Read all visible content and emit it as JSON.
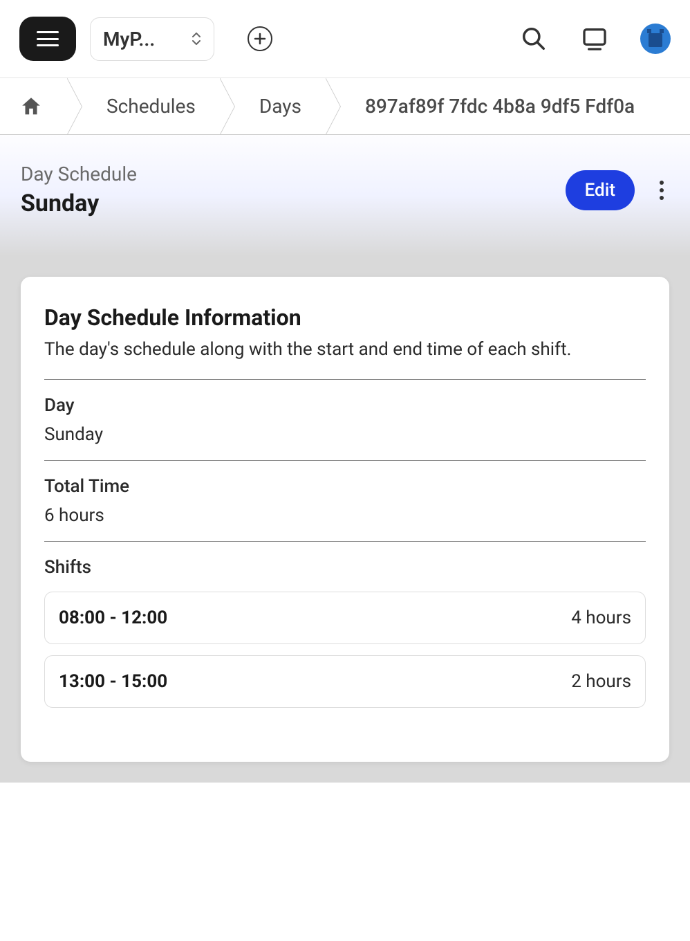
{
  "topbar": {
    "project_label": "MyP..."
  },
  "breadcrumb": {
    "items": [
      "Schedules",
      "Days",
      "897af89f 7fdc 4b8a 9df5 Fdf0a"
    ]
  },
  "header": {
    "subtitle": "Day Schedule",
    "title": "Sunday",
    "edit_label": "Edit"
  },
  "card": {
    "title": "Day Schedule Information",
    "description": "The day's schedule along with the start and end time of each shift.",
    "fields": {
      "day": {
        "label": "Day",
        "value": "Sunday"
      },
      "total_time": {
        "label": "Total Time",
        "value": "6 hours"
      },
      "shifts": {
        "label": "Shifts"
      }
    },
    "shifts": [
      {
        "range": "08:00 - 12:00",
        "duration": "4 hours"
      },
      {
        "range": "13:00 - 15:00",
        "duration": "2 hours"
      }
    ]
  }
}
